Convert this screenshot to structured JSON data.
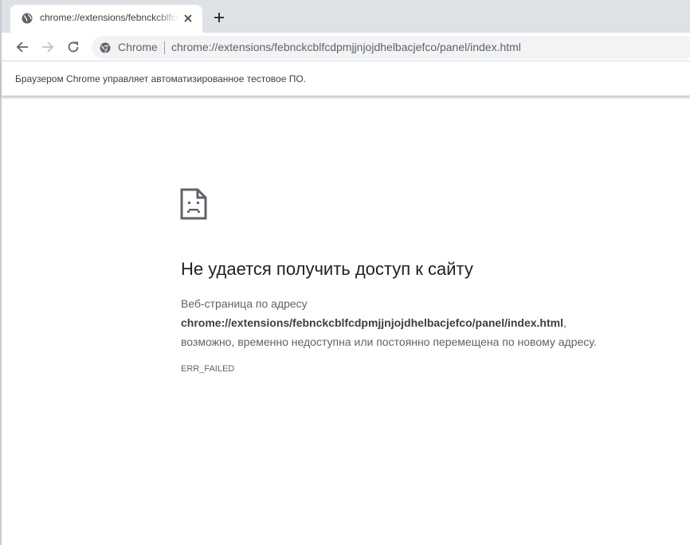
{
  "tab": {
    "title": "chrome://extensions/febnckcblfcdpmjjnjojdhelbacjefco/panel/index.html",
    "favicon": "globe-icon",
    "close_icon": "close-icon"
  },
  "newtab_icon": "plus-icon",
  "toolbar": {
    "back_icon": "arrow-left-icon",
    "forward_icon": "arrow-right-icon",
    "reload_icon": "reload-icon",
    "omnibox": {
      "security_icon": "chrome-logo-icon",
      "origin_label": "Chrome",
      "url": "chrome://extensions/febnckcblfcdpmjjnjojdhelbacjefco/panel/index.html"
    }
  },
  "infobar": {
    "text": "Браузером Chrome управляет автоматизированное тестовое ПО."
  },
  "error_page": {
    "icon": "sad-page-icon",
    "title": "Не удается получить доступ к сайту",
    "desc_line1": "Веб-страница по адресу",
    "desc_url": "chrome://extensions/febnckcblfcdpmjjnjojdhelbacjefco/panel/index.html",
    "desc_comma": ",",
    "desc_line3": "возможно, временно недоступна или постоянно перемещена по новому адресу.",
    "error_code": "ERR_FAILED"
  },
  "colors": {
    "tabstrip_bg": "#dee1e6",
    "omnibox_bg": "#f1f3f4",
    "title_text": "#202124",
    "body_text": "#5f6368"
  }
}
